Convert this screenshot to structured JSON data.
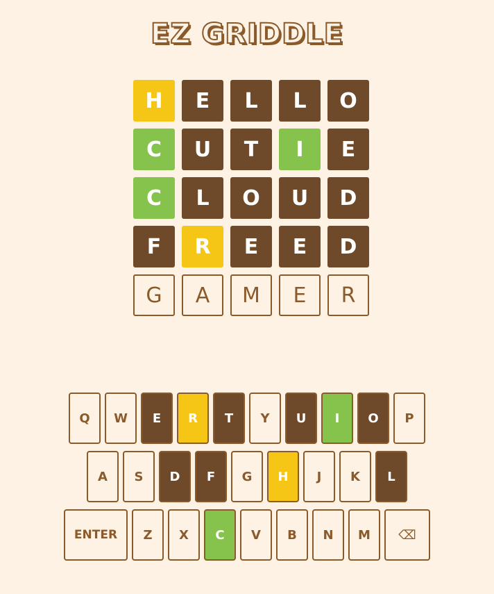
{
  "title": "EZ GRIDDLE",
  "colors": {
    "background": "#fdf2e4",
    "absent": "#6f4a2a",
    "present": "#f6c616",
    "correct": "#86c34c",
    "outline": "#8a5a2b"
  },
  "board": [
    [
      {
        "l": "H",
        "s": "present"
      },
      {
        "l": "E",
        "s": "absent"
      },
      {
        "l": "L",
        "s": "absent"
      },
      {
        "l": "L",
        "s": "absent"
      },
      {
        "l": "O",
        "s": "absent"
      }
    ],
    [
      {
        "l": "C",
        "s": "correct"
      },
      {
        "l": "U",
        "s": "absent"
      },
      {
        "l": "T",
        "s": "absent"
      },
      {
        "l": "I",
        "s": "correct"
      },
      {
        "l": "E",
        "s": "absent"
      }
    ],
    [
      {
        "l": "C",
        "s": "correct"
      },
      {
        "l": "L",
        "s": "absent"
      },
      {
        "l": "O",
        "s": "absent"
      },
      {
        "l": "U",
        "s": "absent"
      },
      {
        "l": "D",
        "s": "absent"
      }
    ],
    [
      {
        "l": "F",
        "s": "absent"
      },
      {
        "l": "R",
        "s": "present"
      },
      {
        "l": "E",
        "s": "absent"
      },
      {
        "l": "E",
        "s": "absent"
      },
      {
        "l": "D",
        "s": "absent"
      }
    ],
    [
      {
        "l": "G",
        "s": "pending"
      },
      {
        "l": "A",
        "s": "pending"
      },
      {
        "l": "M",
        "s": "pending"
      },
      {
        "l": "E",
        "s": "pending"
      },
      {
        "l": "R",
        "s": "pending"
      }
    ]
  ],
  "keyboard": [
    [
      {
        "k": "Q",
        "s": ""
      },
      {
        "k": "W",
        "s": ""
      },
      {
        "k": "E",
        "s": "absent"
      },
      {
        "k": "R",
        "s": "present"
      },
      {
        "k": "T",
        "s": "absent"
      },
      {
        "k": "Y",
        "s": ""
      },
      {
        "k": "U",
        "s": "absent"
      },
      {
        "k": "I",
        "s": "correct"
      },
      {
        "k": "O",
        "s": "absent"
      },
      {
        "k": "P",
        "s": ""
      }
    ],
    [
      {
        "k": "A",
        "s": ""
      },
      {
        "k": "S",
        "s": ""
      },
      {
        "k": "D",
        "s": "absent"
      },
      {
        "k": "F",
        "s": "absent"
      },
      {
        "k": "G",
        "s": ""
      },
      {
        "k": "H",
        "s": "present"
      },
      {
        "k": "J",
        "s": ""
      },
      {
        "k": "K",
        "s": ""
      },
      {
        "k": "L",
        "s": "absent"
      }
    ],
    [
      {
        "k": "ENTER",
        "s": "",
        "t": "wide"
      },
      {
        "k": "Z",
        "s": ""
      },
      {
        "k": "X",
        "s": ""
      },
      {
        "k": "C",
        "s": "correct"
      },
      {
        "k": "V",
        "s": ""
      },
      {
        "k": "B",
        "s": ""
      },
      {
        "k": "N",
        "s": ""
      },
      {
        "k": "M",
        "s": ""
      },
      {
        "k": "⌫",
        "s": "",
        "t": "back"
      }
    ]
  ]
}
